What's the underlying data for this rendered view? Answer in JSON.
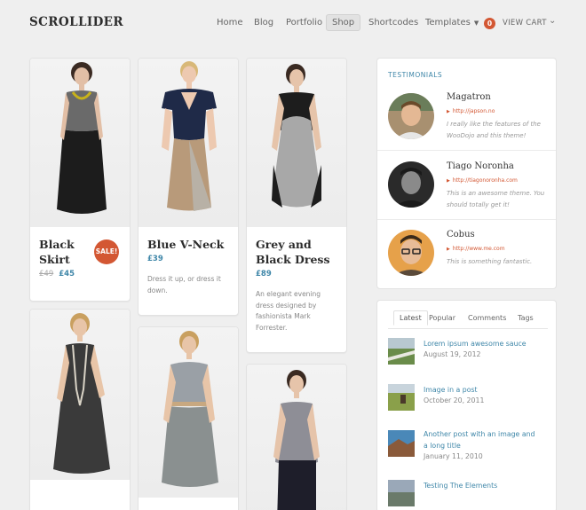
{
  "header": {
    "logo": "SCROLLIDER",
    "nav": [
      {
        "label": "Home"
      },
      {
        "label": "Blog"
      },
      {
        "label": "Portfolio"
      },
      {
        "label": "Shop",
        "active": true
      },
      {
        "label": "Shortcodes"
      },
      {
        "label": "Templates"
      }
    ],
    "cart": {
      "count": "0",
      "label": "VIEW CART"
    }
  },
  "products": [
    {
      "title_line1": "Black",
      "title_line2": "Skirt",
      "old_price": "£49",
      "price": "£45",
      "sale_badge": "SALE!",
      "description": ""
    },
    {
      "title_line1": "Blue V-Neck",
      "title_line2": "",
      "price": "£39",
      "description": "Dress it up, or dress it down."
    },
    {
      "title_line1": "Grey and",
      "title_line2": "Black Dress",
      "price": "£89",
      "description": "An elegant evening dress designed by fashionista Mark Forrester."
    },
    {
      "title_line1": "",
      "title_line2": "",
      "price": "",
      "description": ""
    },
    {
      "title_line1": "",
      "title_line2": "",
      "price": "",
      "description": ""
    },
    {
      "title_line1": "",
      "title_line2": "",
      "price": "",
      "description": ""
    }
  ],
  "testimonials": {
    "heading": "TESTIMONIALS",
    "items": [
      {
        "name": "Magatron",
        "url": "http://japson.no",
        "quote": "I really like the features of the WooDojo and this theme!"
      },
      {
        "name": "Tiago Noronha",
        "url": "http://tiagonoronha.com",
        "quote": "This is an awesome theme. You should totally get it!"
      },
      {
        "name": "Cobus",
        "url": "http://www.me.com",
        "quote": "This is something fantastic."
      }
    ]
  },
  "tabs_widget": {
    "tabs": [
      "Latest",
      "Popular",
      "Comments",
      "Tags"
    ],
    "active_tab": "Latest",
    "posts": [
      {
        "title": "Lorem ipsum awesome sauce",
        "date": "August 19, 2012"
      },
      {
        "title": "Image in a post",
        "date": "October 20, 2011"
      },
      {
        "title": "Another post with an image and a long title",
        "date": "January 11, 2010"
      },
      {
        "title": "Testing The Elements",
        "date": ""
      }
    ]
  },
  "colors": {
    "accent": "#3e86a8",
    "sale": "#d35733",
    "background": "#efefef"
  }
}
